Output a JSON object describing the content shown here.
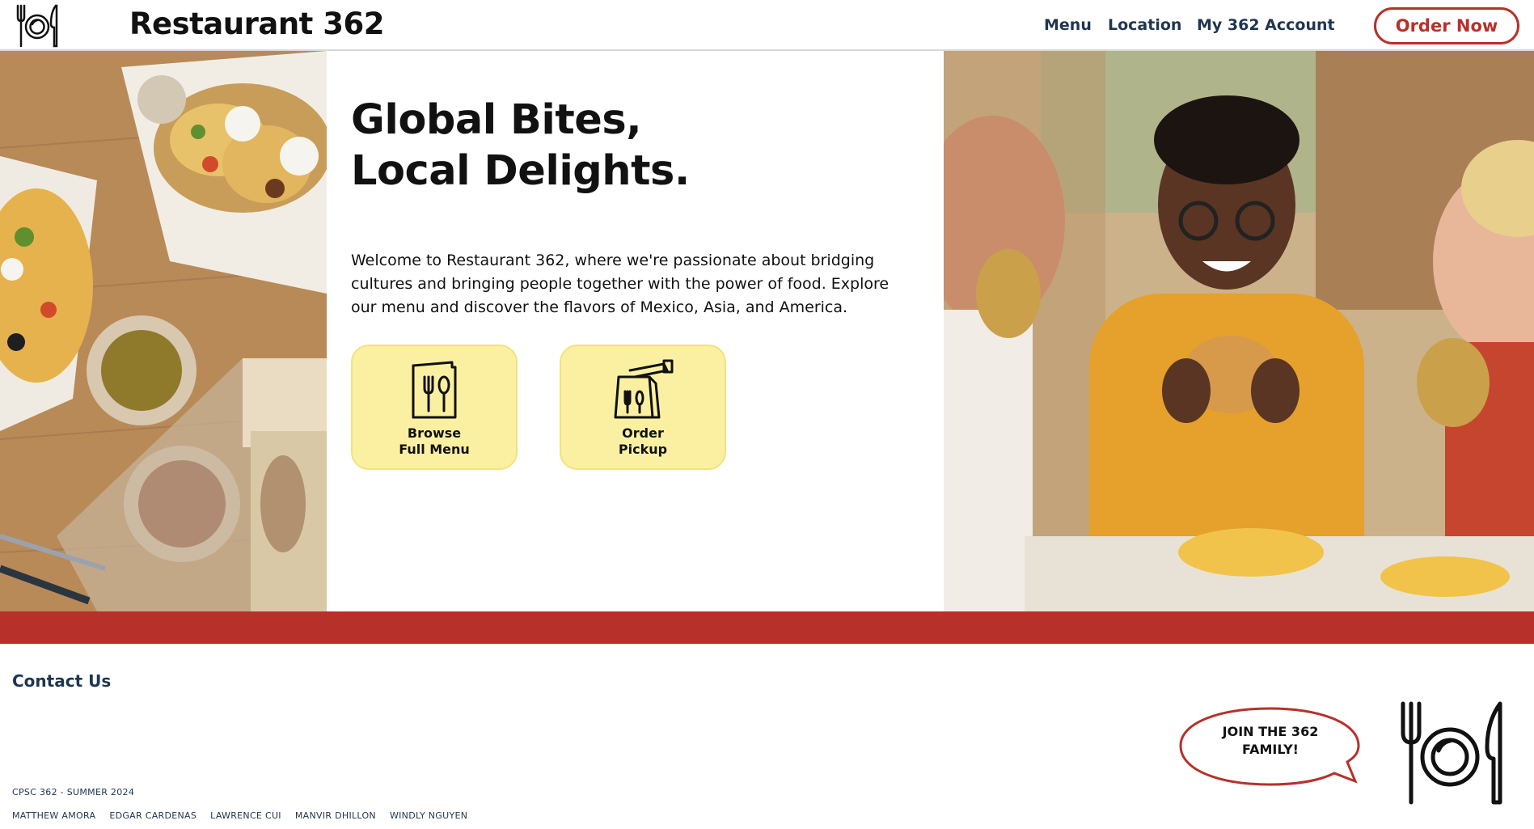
{
  "header": {
    "brand": "Restaurant 362",
    "logo_icon": "plate-fork-knife-icon",
    "nav": {
      "menu": "Menu",
      "location": "Location",
      "account": "My 362 Account"
    },
    "order_now": "Order Now"
  },
  "hero": {
    "headline_line1": "Global Bites,",
    "headline_line2": "Local Delights.",
    "intro": "Welcome to Restaurant 362, where we're passionate about bridging cultures and bringing people together with the power of food. Explore our menu and discover the flavors of Mexico, Asia, and America.",
    "cards": [
      {
        "label": "Browse\nFull Menu",
        "icon": "menu-book-icon"
      },
      {
        "label": "Order\nPickup",
        "icon": "takeout-bag-icon"
      }
    ]
  },
  "footer": {
    "contact_title": "Contact Us",
    "course": "CPSC 362 - SUMMER 2024",
    "names": [
      "MATTHEW AMORA",
      "EDGAR CARDENAS",
      "LAWRENCE CUI",
      "MANVIR DHILLON",
      "WINDLY NGUYEN"
    ],
    "join": "JOIN THE 362\nFAMILY!",
    "logo_icon": "plate-fork-knife-icon"
  },
  "colors": {
    "accent_red": "#b8302a",
    "card_yellow": "#fbf0a2",
    "nav_text": "#1f3550"
  }
}
